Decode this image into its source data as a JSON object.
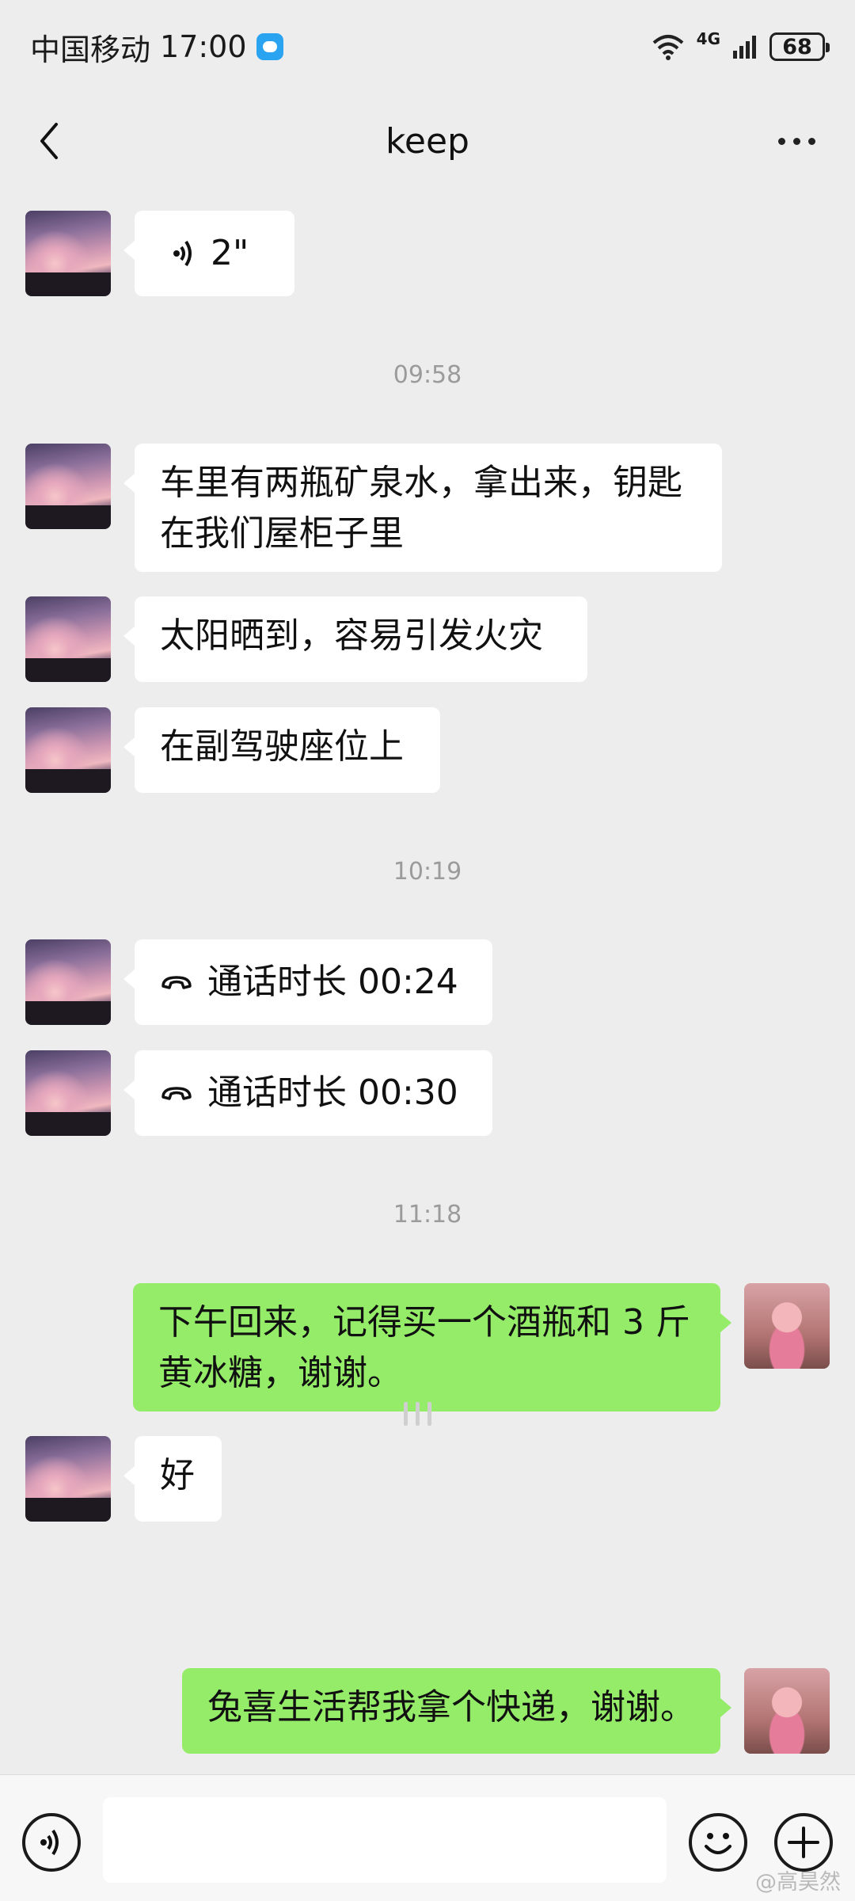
{
  "status_bar": {
    "carrier": "中国移动",
    "time": "17:00",
    "network": "4G",
    "battery": "68"
  },
  "header": {
    "title": "keep",
    "back_icon": "chevron-left-icon",
    "more_icon": "more-dots-icon"
  },
  "messages": [
    {
      "type": "voice",
      "side": "left",
      "duration": "2\""
    },
    {
      "type": "time",
      "text": "09:58"
    },
    {
      "type": "text",
      "side": "left",
      "lines": [
        "车里有两瓶矿泉水，拿出来，钥匙",
        "在我们屋柜子里"
      ]
    },
    {
      "type": "text",
      "side": "left",
      "lines": [
        "太阳晒到，容易引发火灾"
      ]
    },
    {
      "type": "text",
      "side": "left",
      "lines": [
        "在副驾驶座位上"
      ]
    },
    {
      "type": "time",
      "text": "10:19"
    },
    {
      "type": "call",
      "side": "left",
      "text": "通话时长 00:24"
    },
    {
      "type": "call",
      "side": "left",
      "text": "通话时长 00:30"
    },
    {
      "type": "time",
      "text": "11:18"
    },
    {
      "type": "text",
      "side": "right",
      "lines": [
        "下午回来，记得买一个酒瓶和 3 斤",
        "黄冰糖，谢谢。"
      ]
    },
    {
      "type": "text",
      "side": "left",
      "lines": [
        "好"
      ]
    },
    {
      "type": "text",
      "side": "right",
      "lines": [
        "兔喜生活帮我拿个快递，谢谢。"
      ]
    }
  ],
  "input_bar": {
    "value": "",
    "voice_icon": "voice-icon",
    "emoji_icon": "emoji-icon",
    "plus_icon": "plus-icon"
  },
  "watermark": "@高昊然",
  "colors": {
    "background": "#ededed",
    "bubble_left": "#ffffff",
    "bubble_right": "#95ec69",
    "timestamp": "#9b9b9b"
  }
}
